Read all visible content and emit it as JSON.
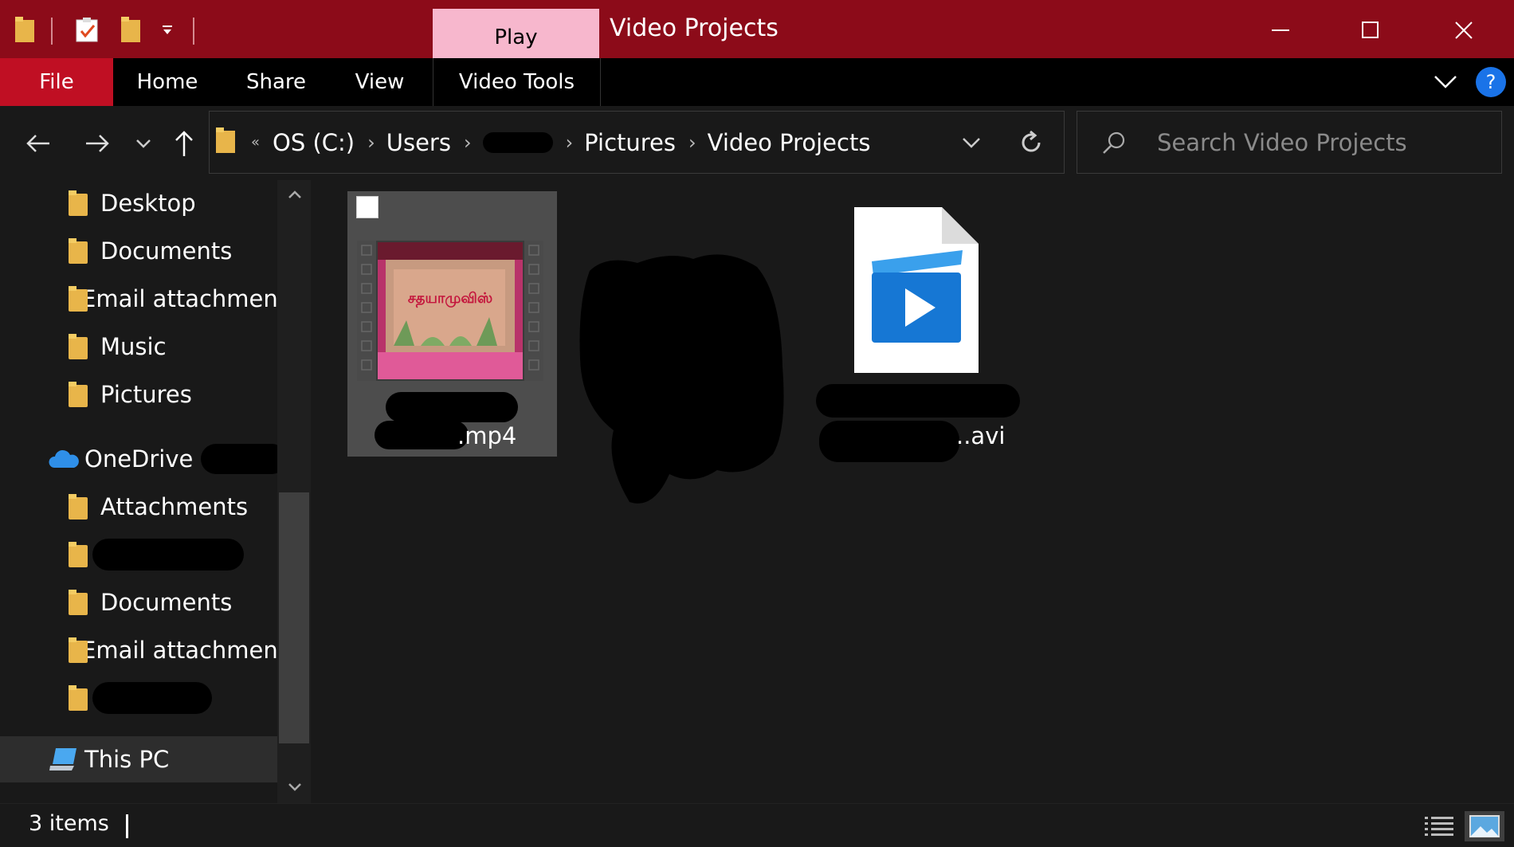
{
  "window": {
    "title": "Video Projects",
    "contextual_tab": "Play",
    "controls": {
      "minimize": "—",
      "maximize": "☐",
      "close": "✕"
    }
  },
  "ribbon": {
    "tabs": [
      "File",
      "Home",
      "Share",
      "View",
      "Video Tools"
    ],
    "help": "?"
  },
  "address": {
    "overflow": "«",
    "crumbs": [
      "OS (C:)",
      "Users",
      "",
      "Pictures",
      "Video Projects"
    ]
  },
  "search": {
    "placeholder": "Search Video Projects"
  },
  "nav": {
    "items": [
      {
        "label": "Desktop"
      },
      {
        "label": "Documents"
      },
      {
        "label": "Email attachments"
      },
      {
        "label": "Music"
      },
      {
        "label": "Pictures"
      },
      {
        "label": "OneDrive"
      },
      {
        "label": "Attachments"
      },
      {
        "label": ""
      },
      {
        "label": "Documents"
      },
      {
        "label": "Email attachments"
      },
      {
        "label": ""
      },
      {
        "label": "This PC"
      }
    ]
  },
  "files": [
    {
      "name_suffix": ".mp4",
      "thumbnail_text": "சதயாமுவிஸ்",
      "selected": true
    },
    {
      "name_suffix": "",
      "redacted": true
    },
    {
      "name_suffix": "..avi",
      "icon": "video-file-icon"
    }
  ],
  "status": {
    "items": "3 items"
  },
  "colors": {
    "titlebar": "#8c0b19",
    "file_tab": "#c00f23",
    "play_tab": "#f7b7cd",
    "background": "#191919",
    "selection": "#4d4d4d"
  }
}
